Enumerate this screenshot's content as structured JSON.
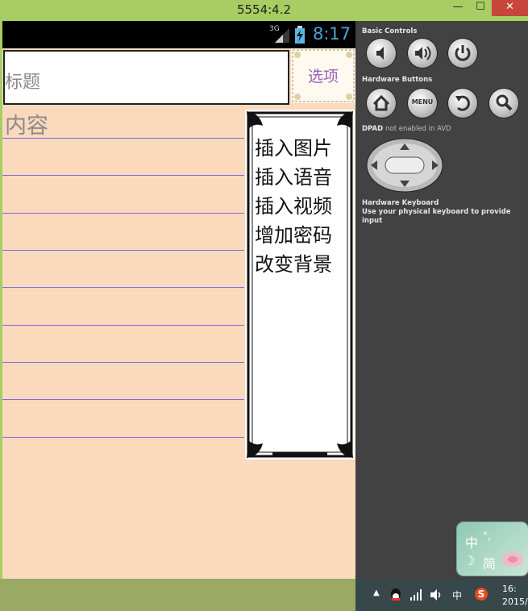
{
  "window": {
    "title": "5554:4.2",
    "min_label": "—",
    "max_label": "☐",
    "close_label": "✕"
  },
  "status_bar": {
    "network": "3G",
    "time": "8:17"
  },
  "app": {
    "title_placeholder": "标题",
    "options_button": "选项",
    "content_placeholder": "内容",
    "menu": [
      "插入图片",
      "插入语音",
      "插入视频",
      "增加密码",
      "改变背景"
    ]
  },
  "controls": {
    "basic_controls": "Basic Controls",
    "hardware_buttons": "Hardware Buttons",
    "menu_label": "MENU",
    "dpad": "DPAD",
    "dpad_note": "not enabled in AVD",
    "keyboard_title": "Hardware Keyboard",
    "keyboard_hint": "Use your physical keyboard to provide input"
  },
  "ime": {
    "lang": "中",
    "punct": "°,",
    "mode": "简",
    "moon": "☽"
  },
  "taskbar": {
    "ime": "中",
    "sogou": "S",
    "clock_time": "16:",
    "clock_date": "2015/"
  },
  "colors": {
    "accent_time": "#4aa3d8",
    "rule_line": "#7b6bd9",
    "window_frame": "#a8cd62",
    "option_text": "#9a5ec0"
  }
}
